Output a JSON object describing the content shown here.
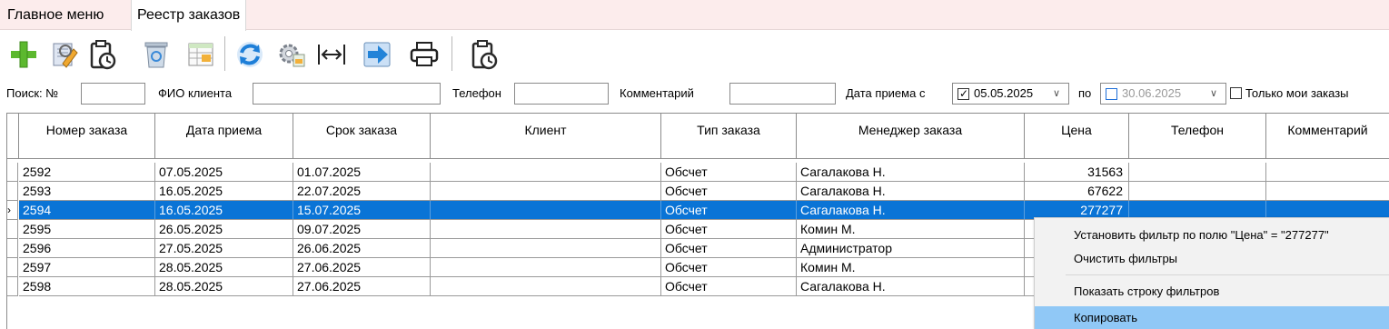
{
  "tabs": [
    {
      "label": "Главное меню"
    },
    {
      "label": "Реестр заказов"
    }
  ],
  "toolbar": {
    "icons": [
      "add-icon",
      "edit-icon",
      "schedule-icon",
      "delete-icon",
      "table-icon",
      "refresh-icon",
      "settings-icon",
      "fit-width-icon",
      "export-icon",
      "print-icon",
      "schedule-icon"
    ]
  },
  "filters": {
    "search_label": "Поиск: №",
    "search_value": "",
    "client_label": "ФИО клиента",
    "client_value": "",
    "phone_label": "Телефон",
    "phone_value": "",
    "comment_label": "Комментарий",
    "comment_value": "",
    "date_from_label": "Дата приема с",
    "date_from": "05.05.2025",
    "date_from_checked": true,
    "date_to_label": "по",
    "date_to": "30.06.2025",
    "date_to_checked": false,
    "only_mine_label": "Только мои заказы",
    "only_mine_checked": false
  },
  "grid": {
    "columns": [
      "Номер заказа",
      "Дата приема",
      "Срок заказа",
      "Клиент",
      "Тип заказа",
      "Менеджер заказа",
      "Цена",
      "Телефон",
      "Комментарий"
    ],
    "rows": [
      {
        "num": "2592",
        "date": "07.05.2025",
        "due": "01.07.2025",
        "client": "",
        "type": "Обсчет",
        "manager": "Сагалакова Н.",
        "price": "31563",
        "phone": "",
        "comment": ""
      },
      {
        "num": "2593",
        "date": "16.05.2025",
        "due": "22.07.2025",
        "client": "",
        "type": "Обсчет",
        "manager": "Сагалакова Н.",
        "price": "67622",
        "phone": "",
        "comment": ""
      },
      {
        "num": "2594",
        "date": "16.05.2025",
        "due": "15.07.2025",
        "client": "",
        "type": "Обсчет",
        "manager": "Сагалакова Н.",
        "price": "277277",
        "phone": "",
        "comment": ""
      },
      {
        "num": "2595",
        "date": "26.05.2025",
        "due": "09.07.2025",
        "client": "",
        "type": "Обсчет",
        "manager": "Комин М.",
        "price": "",
        "phone": "",
        "comment": ""
      },
      {
        "num": "2596",
        "date": "27.05.2025",
        "due": "26.06.2025",
        "client": "",
        "type": "Обсчет",
        "manager": "Администратор",
        "price": "",
        "phone": "",
        "comment": ""
      },
      {
        "num": "2597",
        "date": "28.05.2025",
        "due": "27.06.2025",
        "client": "",
        "type": "Обсчет",
        "manager": "Комин М.",
        "price": "",
        "phone": "",
        "comment": ""
      },
      {
        "num": "2598",
        "date": "28.05.2025",
        "due": "27.06.2025",
        "client": "",
        "type": "Обсчет",
        "manager": "Сагалакова Н.",
        "price": "",
        "phone": "",
        "comment": ""
      }
    ],
    "selected_row": 2,
    "row_indicator": "›"
  },
  "context_menu": {
    "items": [
      {
        "label": "Установить фильтр по полю \"Цена\" = \"277277\""
      },
      {
        "label": "Очистить фильтры"
      },
      {
        "label": "Показать строку фильтров"
      },
      {
        "label": "Копировать"
      }
    ]
  },
  "colors": {
    "selection": "#0a74d6",
    "menu_highlight": "#90c8f6",
    "tabbar_bg": "#fcecec"
  }
}
